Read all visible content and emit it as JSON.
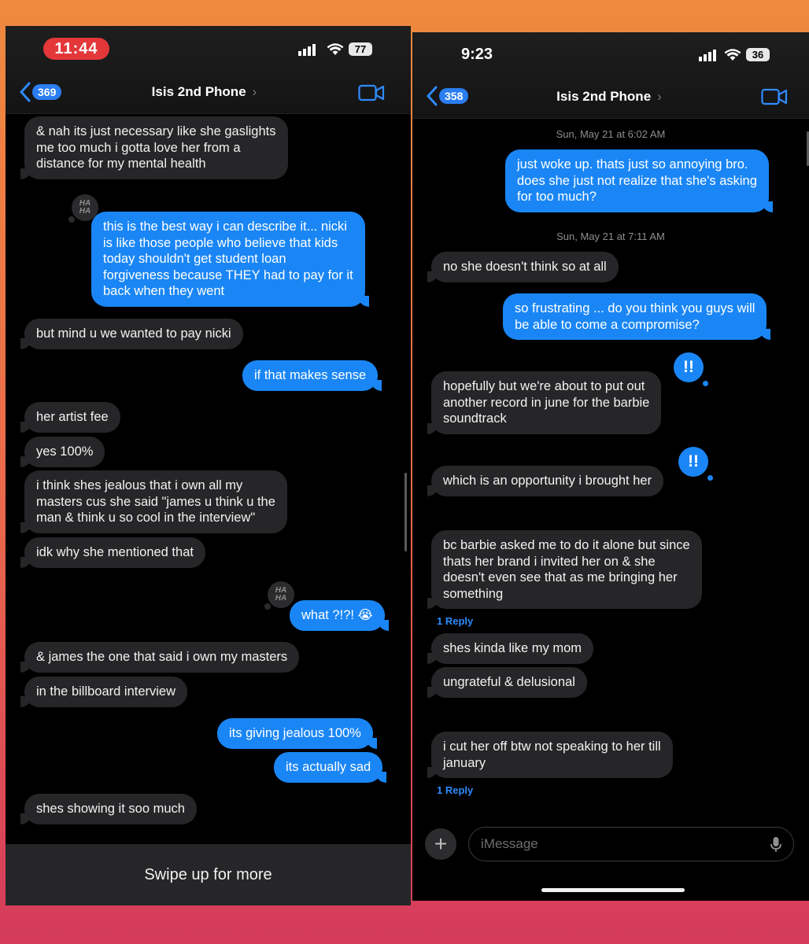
{
  "left": {
    "status": {
      "time": "11:44",
      "battery": "77"
    },
    "nav": {
      "back_count": "369",
      "title": "Isis 2nd Phone"
    },
    "messages": [
      "& nah its just necessary like she gaslights\nme too much i gotta love her from a\ndistance for my mental health",
      "this is the best way i can describe it... nicki\nis like those people who believe that kids\ntoday shouldn't get student loan\nforgiveness because THEY had to pay for it\nback when they went",
      "but mind u we wanted to pay nicki",
      "if that makes sense",
      "her artist fee",
      "yes 100%",
      "i think shes jealous that i own all my\nmasters cus she said \"james u think u the\nman & think u so cool in the interview\"",
      "idk why she mentioned that",
      "what ?!?! 😭",
      "& james the one that said i own my masters",
      "in the billboard interview",
      "its giving jealous 100%",
      "its actually sad",
      "shes showing it soo much"
    ],
    "tapback": "HA HA",
    "swipe_text": "Swipe up for more"
  },
  "right": {
    "status": {
      "time": "9:23",
      "battery": "36"
    },
    "nav": {
      "back_count": "358",
      "title": "Isis 2nd Phone"
    },
    "timestamps": [
      "Sun, May 21 at 6:02 AM",
      "Sun, May 21 at 7:11 AM"
    ],
    "messages": [
      "just woke up. thats just so annoying bro.\ndoes she just not realize that she's asking\nfor too much?",
      "no she doesn't think so at all",
      "so frustrating ... do you think you guys will\nbe able to come a compromise?",
      "hopefully but we're about to put out\nanother record in june for the barbie\nsoundtrack",
      "which is an opportunity i brought her",
      "bc barbie asked me to do it alone but since\nthats her brand i invited her on & she\ndoesn't even see that as me bringing her\nsomething",
      "shes kinda like my mom",
      "ungrateful & delusional",
      "i cut her off btw not speaking to her till\njanuary"
    ],
    "tapback": "!!",
    "reply_label": "1 Reply",
    "input_placeholder": "iMessage",
    "plus_label": "+"
  }
}
